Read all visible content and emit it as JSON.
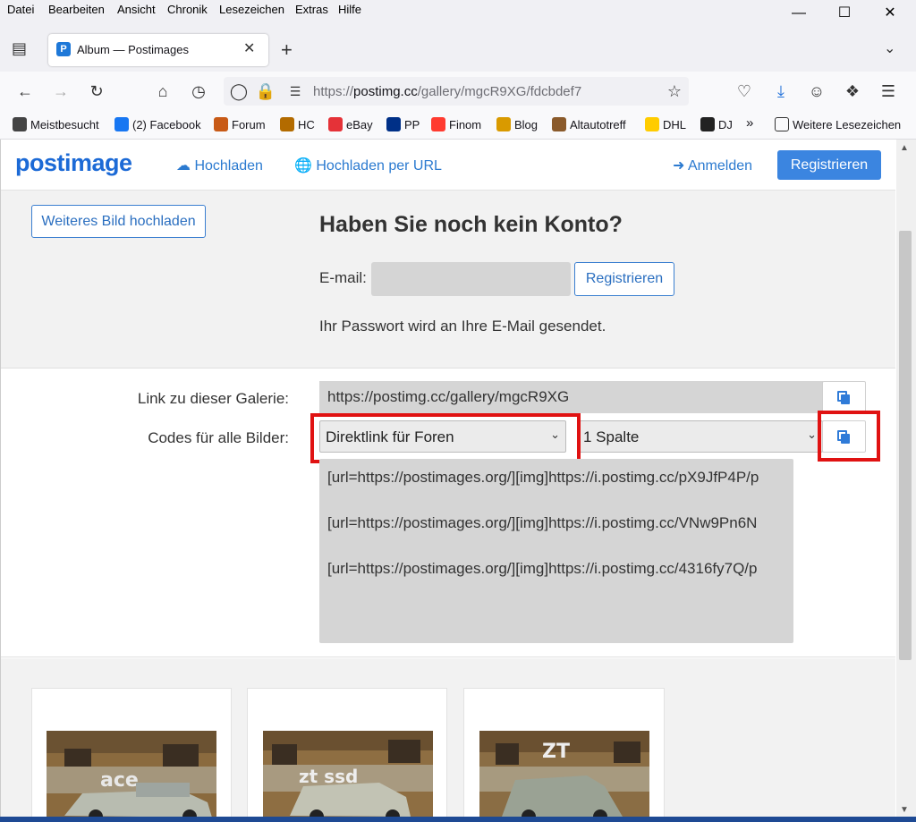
{
  "menubar": {
    "items": [
      "Datei",
      "Bearbeiten",
      "Ansicht",
      "Chronik",
      "Lesezeichen",
      "Extras",
      "Hilfe"
    ]
  },
  "tab": {
    "title": "Album — Postimages",
    "favicon": "P"
  },
  "navbar": {
    "url_prefix": "https://",
    "url_host": "postimg.cc",
    "url_path": "/gallery/mgcR9XG/fdcbdef7"
  },
  "bookmarks": [
    {
      "label": "Meistbesucht",
      "icon": "gear-icon",
      "color": "#444444"
    },
    {
      "label": "(2) Facebook",
      "icon": "facebook-icon",
      "color": "#1877f2"
    },
    {
      "label": "Forum",
      "icon": "forum-icon",
      "color": "#c85a16"
    },
    {
      "label": "HC",
      "icon": "hc-icon",
      "color": "#b36b00"
    },
    {
      "label": "eBay",
      "icon": "ebay-icon",
      "color": "#e53238"
    },
    {
      "label": "PP",
      "icon": "paypal-icon",
      "color": "#003087"
    },
    {
      "label": "Finom",
      "icon": "finom-icon",
      "color": "#ff3b30"
    },
    {
      "label": "Blog",
      "icon": "star-icon",
      "color": "#d99a00"
    },
    {
      "label": "Altautotreff",
      "icon": "car-icon",
      "color": "#8a5a2b"
    },
    {
      "label": "DHL",
      "icon": "dhl-icon",
      "color": "#ffcc00"
    },
    {
      "label": "DJ",
      "icon": "headphones-icon",
      "color": "#222222"
    }
  ],
  "bookmarks_more": "Weitere Lesezeichen",
  "site": {
    "logo_a": "post",
    "logo_b": "image",
    "upload": "Hochladen",
    "upload_url": "Hochladen per URL",
    "login": "Anmelden",
    "register": "Registrieren"
  },
  "promo": {
    "upload_more": "Weiteres Bild hochladen",
    "heading": "Haben Sie noch kein Konto?",
    "email_label": "E-mail:",
    "email_value": "",
    "register": "Registrieren",
    "password_note": "Ihr Passwort wird an Ihre E-Mail gesendet."
  },
  "codes": {
    "gallery_label": "Link zu dieser Galerie:",
    "gallery_link": "https://postimg.cc/gallery/mgcR9XG",
    "codes_label": "Codes für alle Bilder:",
    "code_type": "Direktlink für Foren",
    "columns": "1 Spalte",
    "lines": [
      "[url=https://postimages.org/][img]https://i.postimg.cc/pX9JfP4P/p",
      "[url=https://postimages.org/][img]https://i.postimg.cc/VNw9Pn6N",
      "[url=https://postimages.org/][img]https://i.postimg.cc/4316fy7Q/p"
    ]
  },
  "colors": {
    "accent": "#3b85e0",
    "highlight": "#e01212"
  }
}
